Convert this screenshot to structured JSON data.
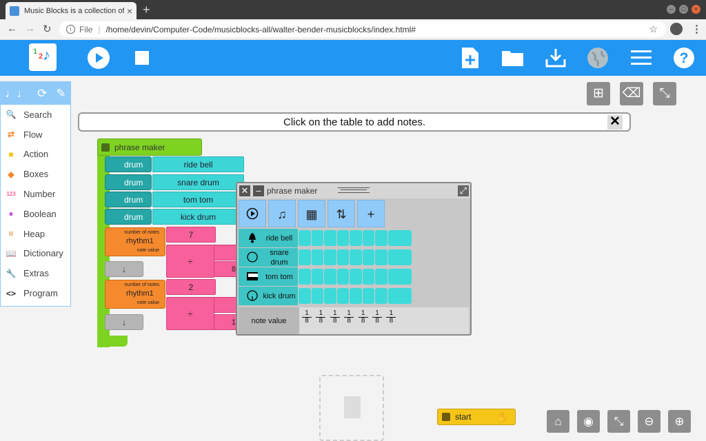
{
  "browser": {
    "tab_title": "Music Blocks is a collection of to",
    "tab_close": "×",
    "new_tab": "+",
    "url_scheme": "File",
    "url": "/home/devin/Computer-Code/musicblocks-all/walter-bender-musicblocks/index.html#"
  },
  "palette": {
    "items": [
      {
        "label": "Search",
        "icon": "search-icon",
        "glyph": "🔍"
      },
      {
        "label": "Flow",
        "icon": "flow-icon",
        "glyph": "⇄"
      },
      {
        "label": "Action",
        "icon": "action-icon",
        "glyph": "■"
      },
      {
        "label": "Boxes",
        "icon": "boxes-icon",
        "glyph": "◆"
      },
      {
        "label": "Number",
        "icon": "number-icon",
        "glyph": "123"
      },
      {
        "label": "Boolean",
        "icon": "boolean-icon",
        "glyph": "●"
      },
      {
        "label": "Heap",
        "icon": "heap-icon",
        "glyph": "≡"
      },
      {
        "label": "Dictionary",
        "icon": "dictionary-icon",
        "glyph": "📖"
      },
      {
        "label": "Extras",
        "icon": "extras-icon",
        "glyph": "🔧"
      },
      {
        "label": "Program",
        "icon": "program-icon",
        "glyph": "<>"
      }
    ]
  },
  "message": "Click on the table to add notes.",
  "program": {
    "phrase_maker": "phrase maker",
    "drum_label": "drum",
    "drums": [
      "ride bell",
      "snare drum",
      "tom tom",
      "kick drum"
    ],
    "rhythm_name": "rhythm1",
    "number_of_notes_label": "number of notes",
    "note_value_label": "note value",
    "rhythm1_count": "7",
    "rhythm2_count": "2",
    "divide": "÷",
    "arg1_partial": "8",
    "arg2_partial": "1",
    "down_arrow": "↓",
    "start": "start"
  },
  "widget": {
    "title": "phrase maker",
    "rows": [
      {
        "label": "ride bell",
        "icon": "bell-icon"
      },
      {
        "label": "snare drum",
        "icon": "snare-drum-icon"
      },
      {
        "label": "tom tom",
        "icon": "tom-tom-icon"
      },
      {
        "label": "kick drum",
        "icon": "kick-drum-icon"
      }
    ],
    "note_value_label": "note value",
    "note_values": [
      {
        "num": "1",
        "den": "8"
      },
      {
        "num": "1",
        "den": "8"
      },
      {
        "num": "1",
        "den": "8"
      },
      {
        "num": "1",
        "den": "8"
      },
      {
        "num": "1",
        "den": "8"
      },
      {
        "num": "1",
        "den": "8"
      },
      {
        "num": "1",
        "den": "8"
      }
    ],
    "add_button": "+"
  },
  "colors": {
    "toolbar": "#2196f3",
    "palette_head": "#90caf9",
    "phrase_maker_block": "#7ed321",
    "drum_block": "#26a6a6",
    "rhythm_block": "#f5892d",
    "number_block": "#f7609a",
    "start_block": "#f5c518"
  }
}
